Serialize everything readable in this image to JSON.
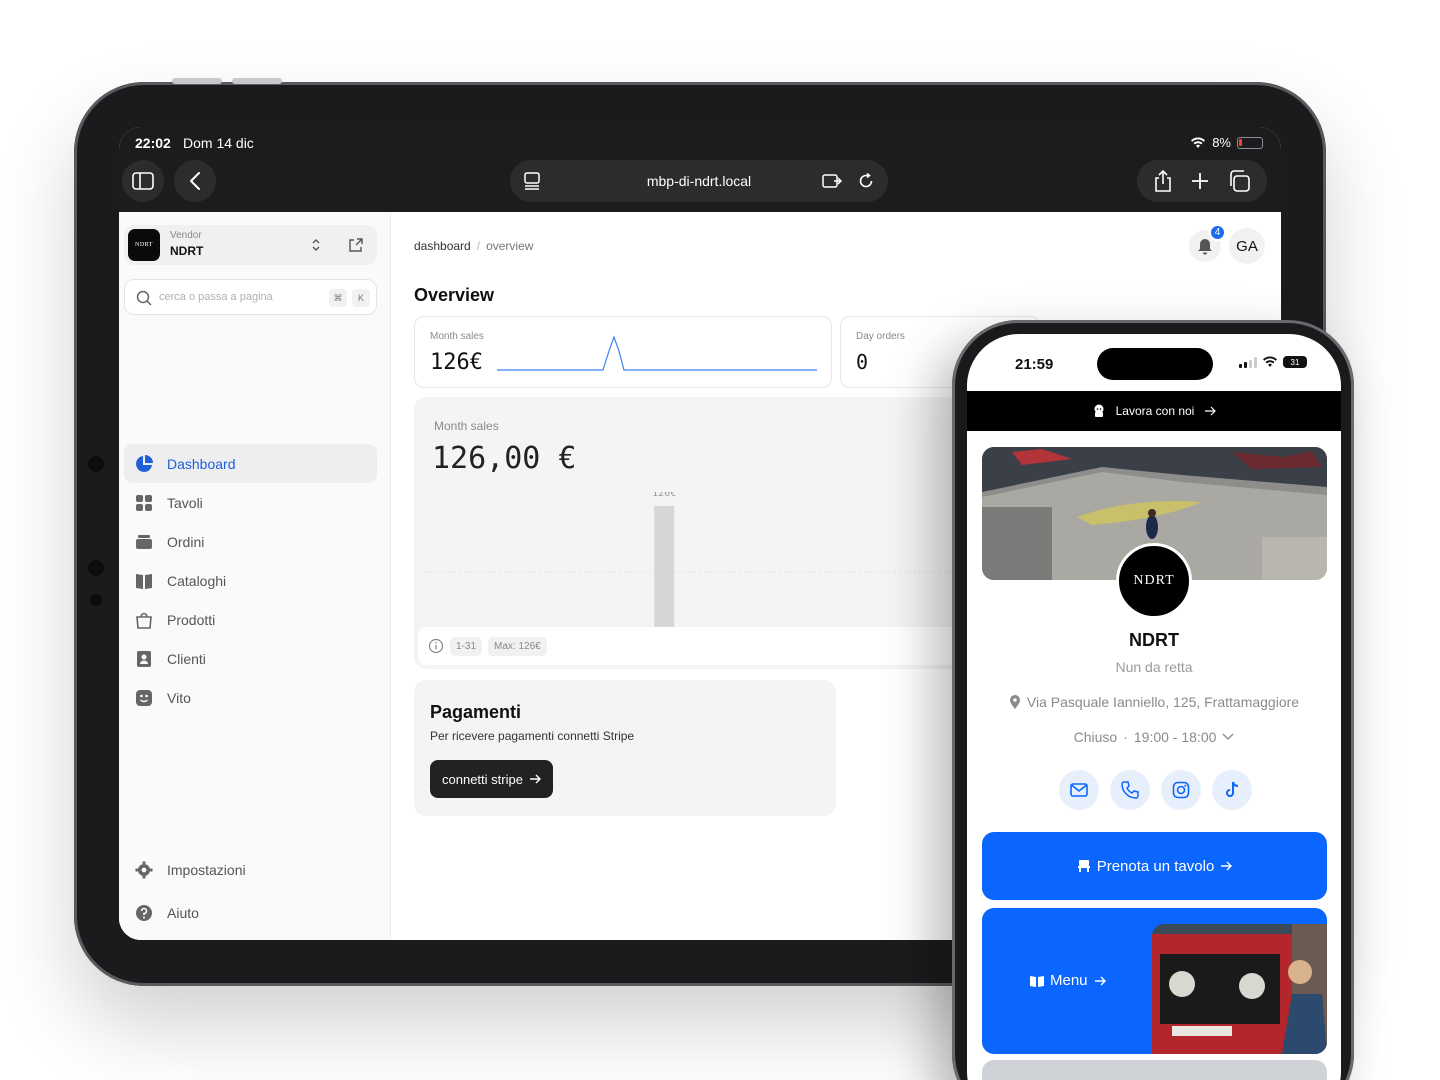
{
  "ipad": {
    "status": {
      "time": "22:02",
      "date": "Dom 14 dic",
      "battery": "8%"
    },
    "url": "mbp-di-ndrt.local",
    "vendor": {
      "label": "Vendor",
      "name": "NDRT",
      "logo_text": "NDRT"
    },
    "search": {
      "placeholder": "cerca o passa a pagina",
      "kbd_cmd": "⌘",
      "kbd_k": "K"
    },
    "nav": {
      "items": [
        {
          "label": "Dashboard",
          "icon": "pie-chart-icon",
          "active": true
        },
        {
          "label": "Tavoli",
          "icon": "grid-icon"
        },
        {
          "label": "Ordini",
          "icon": "tray-icon"
        },
        {
          "label": "Cataloghi",
          "icon": "book-icon"
        },
        {
          "label": "Prodotti",
          "icon": "bag-icon"
        },
        {
          "label": "Clienti",
          "icon": "contacts-icon"
        },
        {
          "label": "Vito",
          "icon": "face-icon"
        }
      ],
      "bottom": [
        {
          "label": "Impostazioni",
          "icon": "gear-icon"
        },
        {
          "label": "Aiuto",
          "icon": "help-icon"
        }
      ]
    },
    "breadcrumb": {
      "root": "dashboard",
      "separator": "/",
      "current": "overview"
    },
    "notifications_count": "4",
    "avatar_initials": "GA",
    "page_title": "Overview",
    "stats": [
      {
        "label": "Month sales",
        "value": "126€"
      },
      {
        "label": "Day orders",
        "value": "0"
      }
    ],
    "chart": {
      "label": "Month sales",
      "total": "126,00 €",
      "bar_label": "126€",
      "footer_range": "1-31",
      "footer_max": "Max: 126€"
    },
    "payments": {
      "title": "Pagamenti",
      "subtitle": "Per ricevere pagamenti connetti Stripe",
      "button": "connetti stripe"
    },
    "accent_color": "#1d5fd8"
  },
  "chart_data": {
    "type": "bar",
    "title": "",
    "xlabel": "",
    "ylabel": "",
    "x_range": "1-31",
    "series": [
      {
        "values": [
          {
            "x": 14,
            "y": 126
          }
        ]
      }
    ],
    "ylim": [
      0,
      126
    ],
    "data_labels": [
      "126€"
    ]
  },
  "iphone": {
    "time": "21:59",
    "battery": "31",
    "banner": "Lavora con noi",
    "logo_text": "NDRT",
    "name": "NDRT",
    "tagline": "Nun da retta",
    "address": "Via Pasquale Ianniello, 125, Frattamaggiore",
    "hours": {
      "status": "Chiuso",
      "dot": "·",
      "range": "19:00 - 18:00"
    },
    "socials": [
      "mail-icon",
      "phone-icon",
      "instagram-icon",
      "tiktok-icon"
    ],
    "cta_reserve": "Prenota un tavolo",
    "cta_menu": "Menu",
    "primary_color": "#0a66ff"
  }
}
